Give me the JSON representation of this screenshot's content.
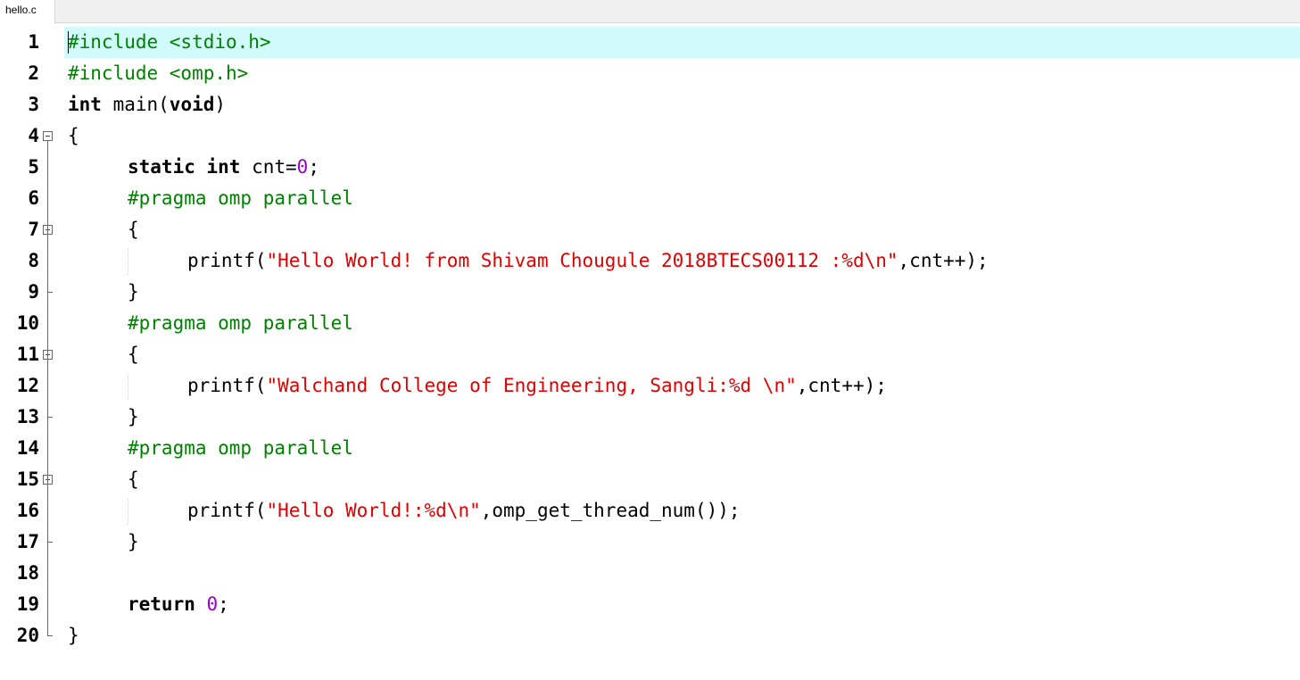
{
  "tab": {
    "label": "hello.c"
  },
  "editor": {
    "current_line": 1,
    "lines": [
      {
        "num": "1",
        "indent": 0,
        "tokens": [
          {
            "t": "pre",
            "v": "#include <stdio.h>"
          }
        ]
      },
      {
        "num": "2",
        "indent": 0,
        "tokens": [
          {
            "t": "pre",
            "v": "#include <omp.h>"
          }
        ]
      },
      {
        "num": "3",
        "indent": 0,
        "tokens": [
          {
            "t": "kw",
            "v": "int"
          },
          {
            "t": "plain",
            "v": " main("
          },
          {
            "t": "kw",
            "v": "void"
          },
          {
            "t": "plain",
            "v": ")"
          }
        ]
      },
      {
        "num": "4",
        "indent": 0,
        "tokens": [
          {
            "t": "plain",
            "v": "{"
          }
        ]
      },
      {
        "num": "5",
        "indent": 1,
        "tokens": [
          {
            "t": "kw",
            "v": "static int"
          },
          {
            "t": "plain",
            "v": " cnt="
          },
          {
            "t": "num",
            "v": "0"
          },
          {
            "t": "plain",
            "v": ";"
          }
        ]
      },
      {
        "num": "6",
        "indent": 1,
        "tokens": [
          {
            "t": "pre",
            "v": "#pragma omp parallel"
          }
        ]
      },
      {
        "num": "7",
        "indent": 1,
        "tokens": [
          {
            "t": "plain",
            "v": "{"
          }
        ]
      },
      {
        "num": "8",
        "indent": 2,
        "tokens": [
          {
            "t": "plain",
            "v": "printf("
          },
          {
            "t": "str",
            "v": "\"Hello World! from Shivam Chougule 2018BTECS00112 :%d\\n\""
          },
          {
            "t": "plain",
            "v": ",cnt++);"
          }
        ]
      },
      {
        "num": "9",
        "indent": 1,
        "tokens": [
          {
            "t": "plain",
            "v": "}"
          }
        ]
      },
      {
        "num": "10",
        "indent": 1,
        "tokens": [
          {
            "t": "pre",
            "v": "#pragma omp parallel"
          }
        ]
      },
      {
        "num": "11",
        "indent": 1,
        "tokens": [
          {
            "t": "plain",
            "v": "{"
          }
        ]
      },
      {
        "num": "12",
        "indent": 2,
        "tokens": [
          {
            "t": "plain",
            "v": "printf("
          },
          {
            "t": "str",
            "v": "\"Walchand College of Engineering, Sangli:%d \\n\""
          },
          {
            "t": "plain",
            "v": ",cnt++);"
          }
        ]
      },
      {
        "num": "13",
        "indent": 1,
        "tokens": [
          {
            "t": "plain",
            "v": "}"
          }
        ]
      },
      {
        "num": "14",
        "indent": 1,
        "tokens": [
          {
            "t": "pre",
            "v": "#pragma omp parallel"
          }
        ]
      },
      {
        "num": "15",
        "indent": 1,
        "tokens": [
          {
            "t": "plain",
            "v": "{"
          }
        ]
      },
      {
        "num": "16",
        "indent": 2,
        "tokens": [
          {
            "t": "plain",
            "v": "printf("
          },
          {
            "t": "str",
            "v": "\"Hello World!:%d\\n\""
          },
          {
            "t": "plain",
            "v": ",omp_get_thread_num());"
          }
        ]
      },
      {
        "num": "17",
        "indent": 1,
        "tokens": [
          {
            "t": "plain",
            "v": "}"
          }
        ]
      },
      {
        "num": "18",
        "indent": 0,
        "tokens": []
      },
      {
        "num": "19",
        "indent": 1,
        "tokens": [
          {
            "t": "kw",
            "v": "return"
          },
          {
            "t": "plain",
            "v": " "
          },
          {
            "t": "num",
            "v": "0"
          },
          {
            "t": "plain",
            "v": ";"
          }
        ]
      },
      {
        "num": "20",
        "indent": 0,
        "tokens": [
          {
            "t": "plain",
            "v": "}"
          }
        ]
      }
    ],
    "fold_open_lines": [
      4,
      7,
      11,
      15
    ],
    "fold_end_lines": [
      9,
      13,
      17
    ],
    "fold_last_line": 20
  },
  "colors": {
    "current_line_bg": "#d1fbfb",
    "preprocessor": "#008000",
    "string": "#e00000",
    "number": "#9b00c9",
    "keyword": "#000000"
  }
}
